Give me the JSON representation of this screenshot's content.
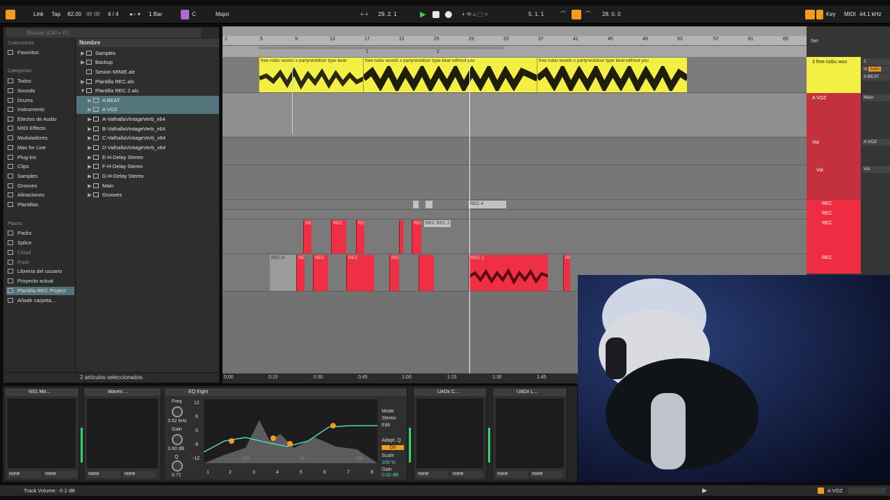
{
  "transport": {
    "link": "Link",
    "tap": "Tap",
    "tempo": "82.00",
    "signature": "4 / 4",
    "quantize": "1 Bar",
    "key": "C",
    "scale": "Major",
    "position": "29.  2.  1",
    "loop_start": "5.  1.  1",
    "loop_length": "28.  0.  0",
    "key_label": "Key",
    "midi_label": "MIDI",
    "sample_rate": "44.1 kHz"
  },
  "browser": {
    "search_placeholder": "Buscar (Ctrl + F)",
    "collections_title": "Colecciones",
    "favorites": "Favoritos",
    "categories_title": "Categorías",
    "categories": [
      "Todos",
      "Sounds",
      "Drums",
      "Instruments",
      "Efectos de Audio",
      "MIDI Effects",
      "Moduladores",
      "Max for Live",
      "Plug-ins",
      "Clips",
      "Samples",
      "Grooves",
      "Afinaciones",
      "Plantillas"
    ],
    "places_title": "Places",
    "places": [
      "Packs",
      "Splice",
      "Cloud",
      "Push",
      "Librería del usuario",
      "Proyecto actual",
      "Plantilla REC Project",
      "Añadir carpeta..."
    ],
    "column_header": "Nombre",
    "files": [
      "Samples",
      "Backup",
      "Sesion MINIE.alc",
      "Plantilla REC.als",
      "Plantilla REC 2.als",
      "A BEAT",
      "A VOZ",
      "A-ValhallaVintageVerb_x64",
      "B-ValhallaVintageVerb_x64",
      "C-ValhallaVintageVerb_x64",
      "D-ValhallaVintageVerb_x64",
      "E-H-Delay Stereo",
      "F-H-Delay Stereo",
      "G-H-Delay Stereo",
      "Main",
      "Grooves"
    ],
    "status": "2 artículos seleccionados"
  },
  "arrangement": {
    "ruler": [
      "1",
      "5",
      "9",
      "13",
      "17",
      "21",
      "25",
      "29",
      "33",
      "37",
      "41",
      "45",
      "49",
      "53",
      "57",
      "61",
      "65"
    ],
    "locators": [
      "1",
      "2"
    ],
    "beat_clip_titles": [
      "free  nobu woods x partynextdoor type beat",
      "free  nobu woods x partynextdoor type beat  without you",
      "free  nobu woods x partynextdoor type beat without you"
    ],
    "rec_clips_grey": [
      "REC 4",
      "REC REC 2",
      "REC 8"
    ],
    "rec_clips_red": [
      "REC",
      "REC",
      "REC",
      "REC",
      "REC",
      "REC",
      "REC",
      "REC",
      "REC 2",
      "REC"
    ],
    "time_labels": [
      "0:00",
      "0:15",
      "0:30",
      "0:45",
      "1:00",
      "1:15",
      "1:30",
      "1:45"
    ],
    "set_label": "Set"
  },
  "tracks": {
    "beat_name": "3 free  nobu woo",
    "voz_name": "A VOZ",
    "vol1": "Vol",
    "vol2": "Vol",
    "rec_names": [
      "REC",
      "REC",
      "REC",
      "REC"
    ],
    "io": {
      "in": "In",
      "auto": "Auto",
      "route_beat": "A BEAT",
      "main": "Main",
      "route_voz": "A VOZ",
      "vol_label": "Vol",
      "num1": "1"
    }
  },
  "devices": {
    "dev1": "NS1 Mo...",
    "dev2": "Waves ...",
    "eq_title": "EQ Eight",
    "freq_label": "Freq",
    "freq_value": "3.52 kHz",
    "gain_label": "Gain",
    "gain_value": "3.60 dB",
    "q_label": "Q",
    "q_value": "0.71",
    "db_scale": [
      "12",
      "6",
      "0",
      "-6",
      "-12"
    ],
    "freq_scale": [
      "100",
      "1k",
      "10k"
    ],
    "mode_label": "Mode",
    "mode_value": "Stereo",
    "edit_label": "Edit",
    "adapt_label": "Adapt. Q",
    "adapt_value": "On",
    "scale_label": "Scale",
    "scale_value": "100 %",
    "gain2_label": "Gain",
    "gain2_value": "0.00 dB",
    "bands": [
      "1",
      "2",
      "3",
      "4",
      "5",
      "6",
      "7",
      "8"
    ],
    "dev4": "UADx C...",
    "dev5": "UADx L...",
    "none": "none"
  },
  "status": {
    "left": "Track Volume: -0.2 dB",
    "right_track": "A VOZ"
  },
  "colors": {
    "accent_orange": "#f39b1e",
    "beat_yellow": "#f4ef45",
    "rec_red": "#ef2f43",
    "selection": "#54747b"
  }
}
